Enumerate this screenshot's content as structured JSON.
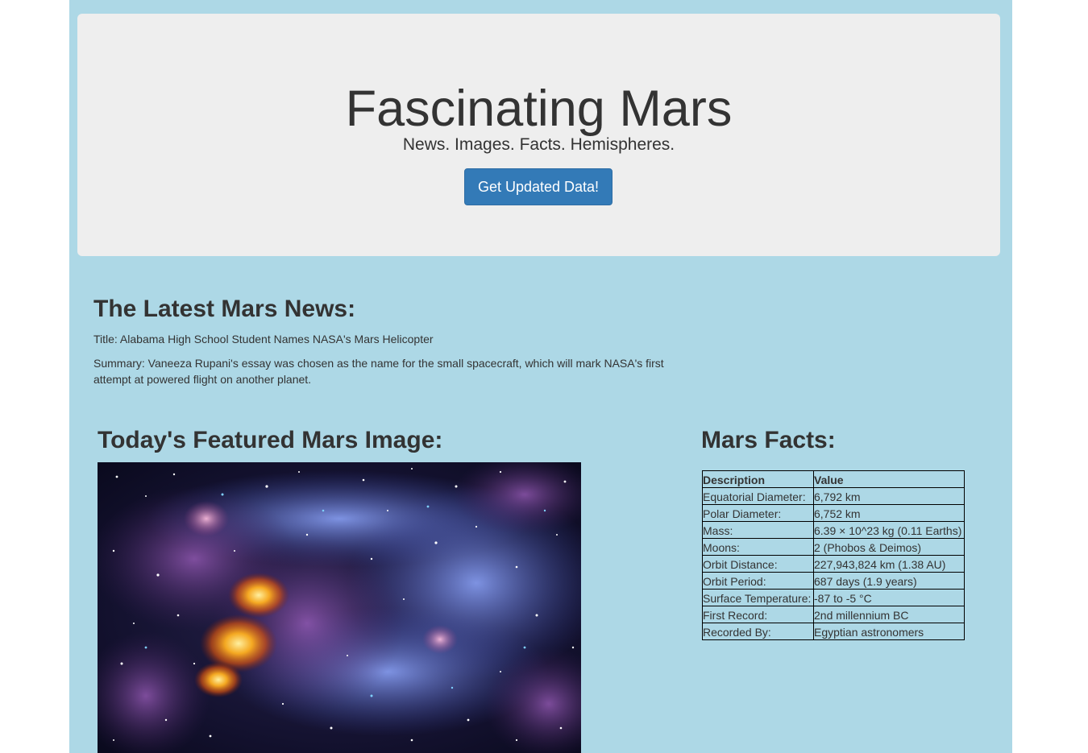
{
  "jumbotron": {
    "title": "Fascinating Mars",
    "subtitle": "News. Images. Facts. Hemispheres.",
    "button_label": "Get Updated Data!"
  },
  "news": {
    "heading": "The Latest Mars News:",
    "title": "Title: Alabama High School Student Names NASA's Mars Helicopter",
    "summary": "Summary: Vaneeza Rupani's essay was chosen as the name for the small spacecraft, which will mark NASA's first attempt at powered flight on another planet."
  },
  "featured": {
    "heading": "Today's Featured Mars Image:"
  },
  "facts": {
    "heading": "Mars Facts:",
    "columns": [
      "Description",
      "Value"
    ],
    "rows": [
      {
        "label": "Equatorial Diameter:",
        "value": "6,792 km"
      },
      {
        "label": "Polar Diameter:",
        "value": "6,752 km"
      },
      {
        "label": "Mass:",
        "value": "6.39 × 10^23 kg (0.11 Earths)"
      },
      {
        "label": "Moons:",
        "value": "2 (Phobos & Deimos)"
      },
      {
        "label": "Orbit Distance:",
        "value": "227,943,824 km (1.38 AU)"
      },
      {
        "label": "Orbit Period:",
        "value": "687 days (1.9 years)"
      },
      {
        "label": "Surface Temperature:",
        "value": "-87 to -5 °C"
      },
      {
        "label": "First Record:",
        "value": "2nd millennium BC"
      },
      {
        "label": "Recorded By:",
        "value": "Egyptian astronomers"
      }
    ]
  },
  "colors": {
    "page_background": "#add8e6",
    "jumbotron_background": "#eeeeee",
    "button_primary": "#337ab7",
    "text": "#333333"
  }
}
